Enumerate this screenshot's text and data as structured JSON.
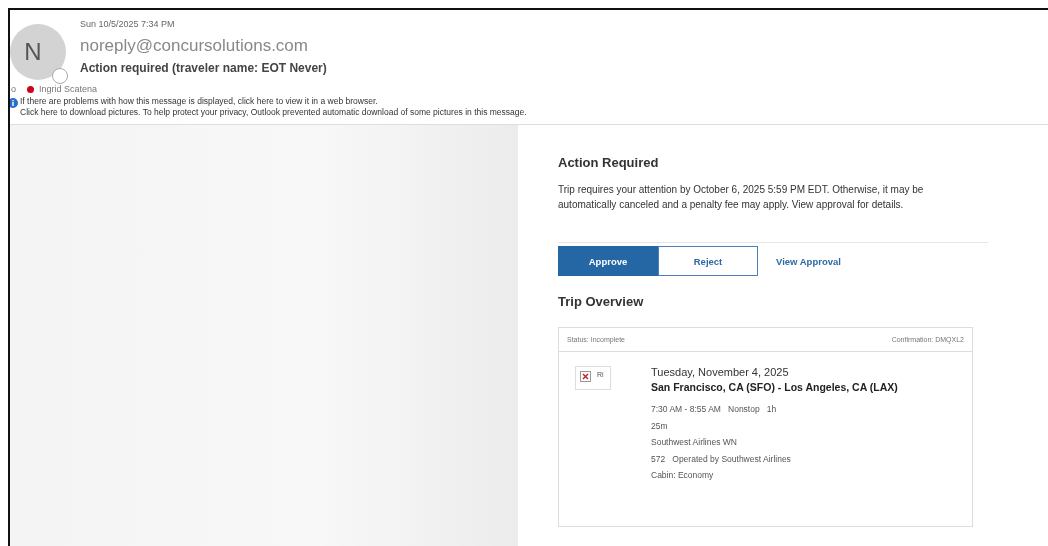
{
  "header": {
    "avatar_letter": "N",
    "date": "Sun 10/5/2025 7:34 PM",
    "sender": "noreply@concursolutions.com",
    "subject": "Action required (traveler name: EOT Never)",
    "to_label": "o",
    "recipient": {
      "name": "Ingrid Scatena",
      "color": "#d0021b"
    },
    "info_lines": [
      "If there are problems with how this message is displayed, click here to view it in a web browser.",
      "Click here to download pictures. To help protect your privacy, Outlook prevented automatic download of some pictures in this message."
    ]
  },
  "body": {
    "title": "Action Required",
    "message": "Trip requires your attention by October 6, 2025 5:59 PM EDT. Otherwise, it may be automatically canceled and a penalty fee may apply. View approval for details.",
    "actions": [
      {
        "kind": "primary",
        "label": "Approve"
      },
      {
        "kind": "outline",
        "label": "Reject"
      },
      {
        "kind": "link",
        "label": "View Approval"
      }
    ],
    "overview_title": "Trip Overview",
    "trip": {
      "status": "Status: Incomplete",
      "confirmation": "Confirmation: DMQXL2",
      "image_alt": "Ri",
      "date": "Tuesday, November 4, 2025",
      "route": "San Francisco, CA (SFO) - Los Angeles, CA (LAX)",
      "details": [
        "7:30 AM - 8:55 AM   Nonstop   1h",
        "25m",
        "Southwest Airlines WN",
        "572   Operated by Southwest Airlines",
        "Cabin: Economy"
      ]
    }
  }
}
